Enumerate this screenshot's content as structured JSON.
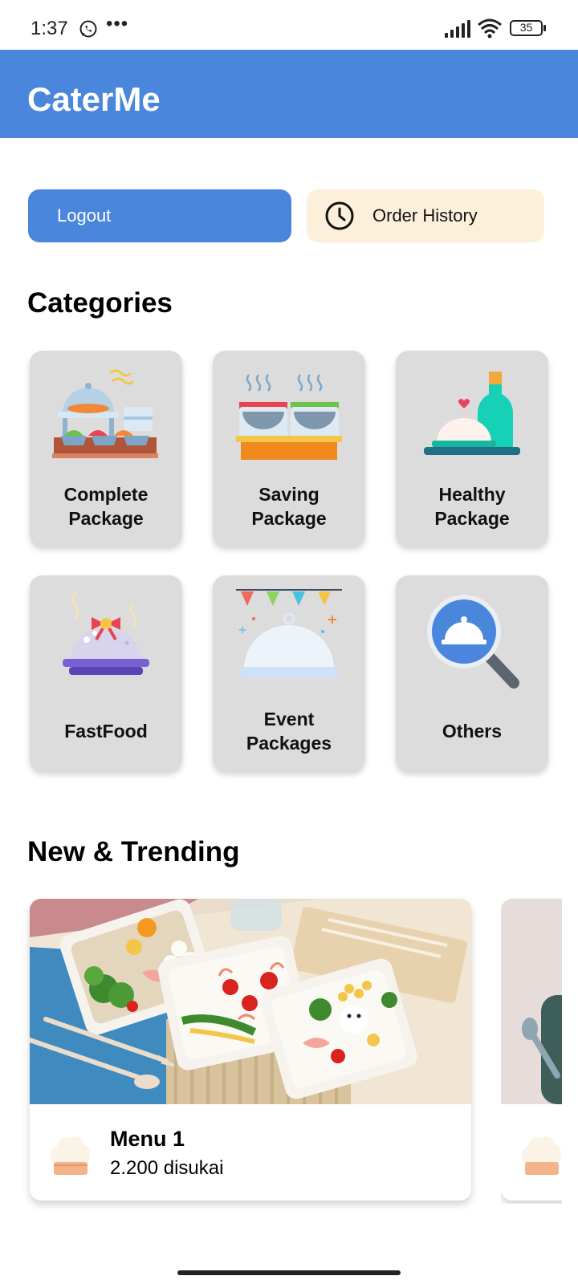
{
  "status_bar": {
    "time": "1:37",
    "battery": "35"
  },
  "app_title": "CaterMe",
  "actions": {
    "logout_label": "Logout",
    "order_history_label": "Order History"
  },
  "categories_heading": "Categories",
  "categories": [
    {
      "line1": "Complete",
      "line2": "Package"
    },
    {
      "line1": "Saving",
      "line2": "Package"
    },
    {
      "line1": "Healthy",
      "line2": "Package"
    },
    {
      "line1": "FastFood",
      "line2": ""
    },
    {
      "line1": "Event",
      "line2": "Packages"
    },
    {
      "line1": "Others",
      "line2": ""
    }
  ],
  "trending_heading": "New & Trending",
  "trending": [
    {
      "name": "Menu 1",
      "likes": "2.200 disukai"
    }
  ],
  "colors": {
    "primary": "#4a86dc",
    "history_bg": "#fdf0da",
    "card_bg": "#dcdcdc"
  }
}
